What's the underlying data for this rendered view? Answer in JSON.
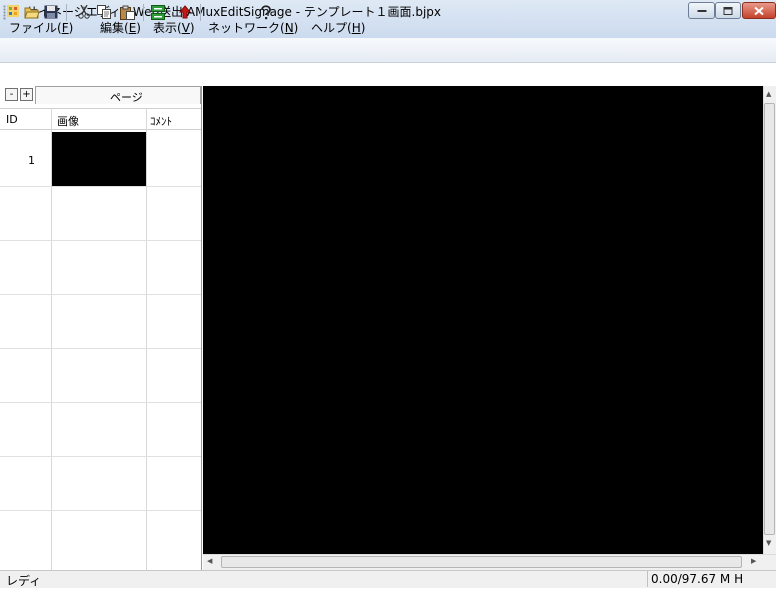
{
  "window": {
    "title": "サイネージエディトWeb送出 AMuxEditSignage - テンプレート１画面.bjpx"
  },
  "menu": {
    "file": {
      "label": "ファイル(",
      "key": "F",
      "end": ")"
    },
    "edit": {
      "label": "編集(",
      "key": "E",
      "end": ")"
    },
    "view": {
      "label": "表示(",
      "key": "V",
      "end": ")"
    },
    "network": {
      "label": "ネットワーク(",
      "key": "N",
      "end": ")"
    },
    "help": {
      "label": "ヘルプ(",
      "key": "H",
      "end": ")"
    }
  },
  "toolbar": {
    "icons": [
      "open-icon",
      "save-icon",
      "cut-icon",
      "copy-icon",
      "paste-icon",
      "send-icon",
      "upload-arrow-icon",
      "help-icon"
    ]
  },
  "left_panel": {
    "collapse_label": "-",
    "expand_label": "+",
    "tab_label": "ページ",
    "columns": [
      "ID",
      "画像",
      "ｺﾒﾝﾄ"
    ],
    "rows": [
      {
        "id": "1",
        "comment": ""
      }
    ]
  },
  "status": {
    "left": "レディ",
    "right": "0.00/97.67 M  H"
  },
  "colors": {
    "canvas": "#000000",
    "titlebar": "#c9d9ee"
  }
}
